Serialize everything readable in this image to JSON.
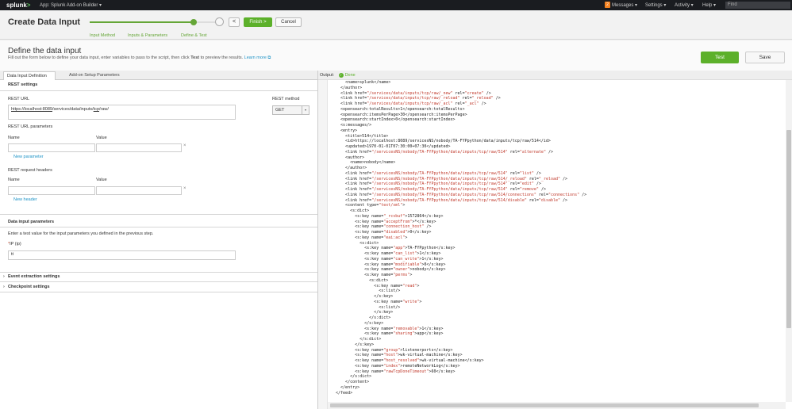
{
  "topbar": {
    "logo": "splunk",
    "app_label": "App: Splunk Add-on Builder ▾",
    "messages_count": "2",
    "messages_label": "Messages ▾",
    "settings_label": "Settings ▾",
    "activity_label": "Activity ▾",
    "help_label": "Help ▾",
    "find_placeholder": "Find"
  },
  "header": {
    "title": "Create Data Input",
    "steps": [
      "Input Method",
      "Inputs & Parameters",
      "Define & Test"
    ],
    "back_label": "<",
    "finish_label": "Finish >",
    "cancel_label": "Cancel"
  },
  "define": {
    "heading": "Define the data input",
    "description": "Fill out the form below to define your data input, enter variables to pass to the script, then click ",
    "description_bold": "Test",
    "description_end": " to preview the results. ",
    "learn_more": "Learn more",
    "test_label": "Test",
    "save_label": "Save"
  },
  "tabs": [
    "Data Input Definition",
    "Add-on Setup Parameters"
  ],
  "form": {
    "rest_settings": "REST settings",
    "rest_url_label": "REST URL",
    "rest_url_scheme": "https://",
    "rest_url_host": "localhost:8089",
    "rest_url_path_a": "/services/data/inputs/",
    "rest_url_tcp": "tcp",
    "rest_url_path_b": "/raw/",
    "rest_method_label": "REST method",
    "rest_method_value": "GET",
    "url_params_title": "REST URL parameters",
    "name_label": "Name",
    "value_label": "Value",
    "new_parameter": "New parameter",
    "headers_title": "REST request headers",
    "new_header": "New header",
    "data_input_params": "Data input parameters",
    "data_input_desc": "Enter a test value for the input parameters you defined in the previous step.",
    "ip_label": "IP (ip)",
    "ip_required": "*",
    "ip_value": "tt",
    "event_extraction": "Event extraction settings",
    "checkpoint": "Checkpoint settings"
  },
  "output": {
    "label": "Output:",
    "status": "Done",
    "lines": [
      "      <name>splunk</name>",
      "    </author>",
      "    <link href=\"/services/data/inputs/tcp/raw/_new\" rel=\"create\" />",
      "    <link href=\"/services/data/inputs/tcp/raw/_reload\" rel=\"_reload\" />",
      "    <link href=\"/services/data/inputs/tcp/raw/_acl\" rel=\"_acl\" />",
      "    <opensearch:totalResults>1</opensearch:totalResults>",
      "    <opensearch:itemsPerPage>30</opensearch:itemsPerPage>",
      "    <opensearch:startIndex>0</opensearch:startIndex>",
      "    <s:messages/>",
      "    <entry>",
      "      <title>514</title>",
      "      <id>https://localhost:8089/servicesNS/nobody/TA-FYPpython/data/inputs/tcp/raw/514</id>",
      "      <updated>1970-01-01T07:30:00+07:30</updated>",
      "      <link href=\"/servicesNS/nobody/TA-FYPpython/data/inputs/tcp/raw/514\" rel=\"alternate\" />",
      "      <author>",
      "        <name>nobody</name>",
      "      </author>",
      "      <link href=\"/servicesNS/nobody/TA-FYPpython/data/inputs/tcp/raw/514\" rel=\"list\" />",
      "      <link href=\"/servicesNS/nobody/TA-FYPpython/data/inputs/tcp/raw/514/_reload\" rel=\"_reload\" />",
      "      <link href=\"/servicesNS/nobody/TA-FYPpython/data/inputs/tcp/raw/514\" rel=\"edit\" />",
      "      <link href=\"/servicesNS/nobody/TA-FYPpython/data/inputs/tcp/raw/514\" rel=\"remove\" />",
      "      <link href=\"/servicesNS/nobody/TA-FYPpython/data/inputs/tcp/raw/514/connections\" rel=\"connections\" />",
      "      <link href=\"/servicesNS/nobody/TA-FYPpython/data/inputs/tcp/raw/514/disable\" rel=\"disable\" />",
      "      <content type=\"text/xml\">",
      "        <s:dict>",
      "          <s:key name=\"_rcvbuf\">1572864</s:key>",
      "          <s:key name=\"acceptFrom\">*</s:key>",
      "          <s:key name=\"connection_host\" />",
      "          <s:key name=\"disabled\">0</s:key>",
      "          <s:key name=\"eai:acl\">",
      "            <s:dict>",
      "              <s:key name=\"app\">TA-FYPpython</s:key>",
      "              <s:key name=\"can_list\">1</s:key>",
      "              <s:key name=\"can_write\">1</s:key>",
      "              <s:key name=\"modifiable\">0</s:key>",
      "              <s:key name=\"owner\">nobody</s:key>",
      "              <s:key name=\"perms\">",
      "                <s:dict>",
      "                  <s:key name=\"read\">",
      "                    <s:list/>",
      "                  </s:key>",
      "                  <s:key name=\"write\">",
      "                    <s:list/>",
      "                  </s:key>",
      "                </s:dict>",
      "              </s:key>",
      "              <s:key name=\"removable\">1</s:key>",
      "              <s:key name=\"sharing\">app</s:key>",
      "            </s:dict>",
      "          </s:key>",
      "          <s:key name=\"group\">listenerports</s:key>",
      "          <s:key name=\"host\">wk-virtual-machine</s:key>",
      "          <s:key name=\"host_resolved\">wk-virtual-machine</s:key>",
      "          <s:key name=\"index\">remoteNetworkLog</s:key>",
      "          <s:key name=\"rawTcpDoneTimeout\">60</s:key>",
      "        </s:dict>",
      "      </content>",
      "    </entry>",
      "  </feed>"
    ]
  }
}
